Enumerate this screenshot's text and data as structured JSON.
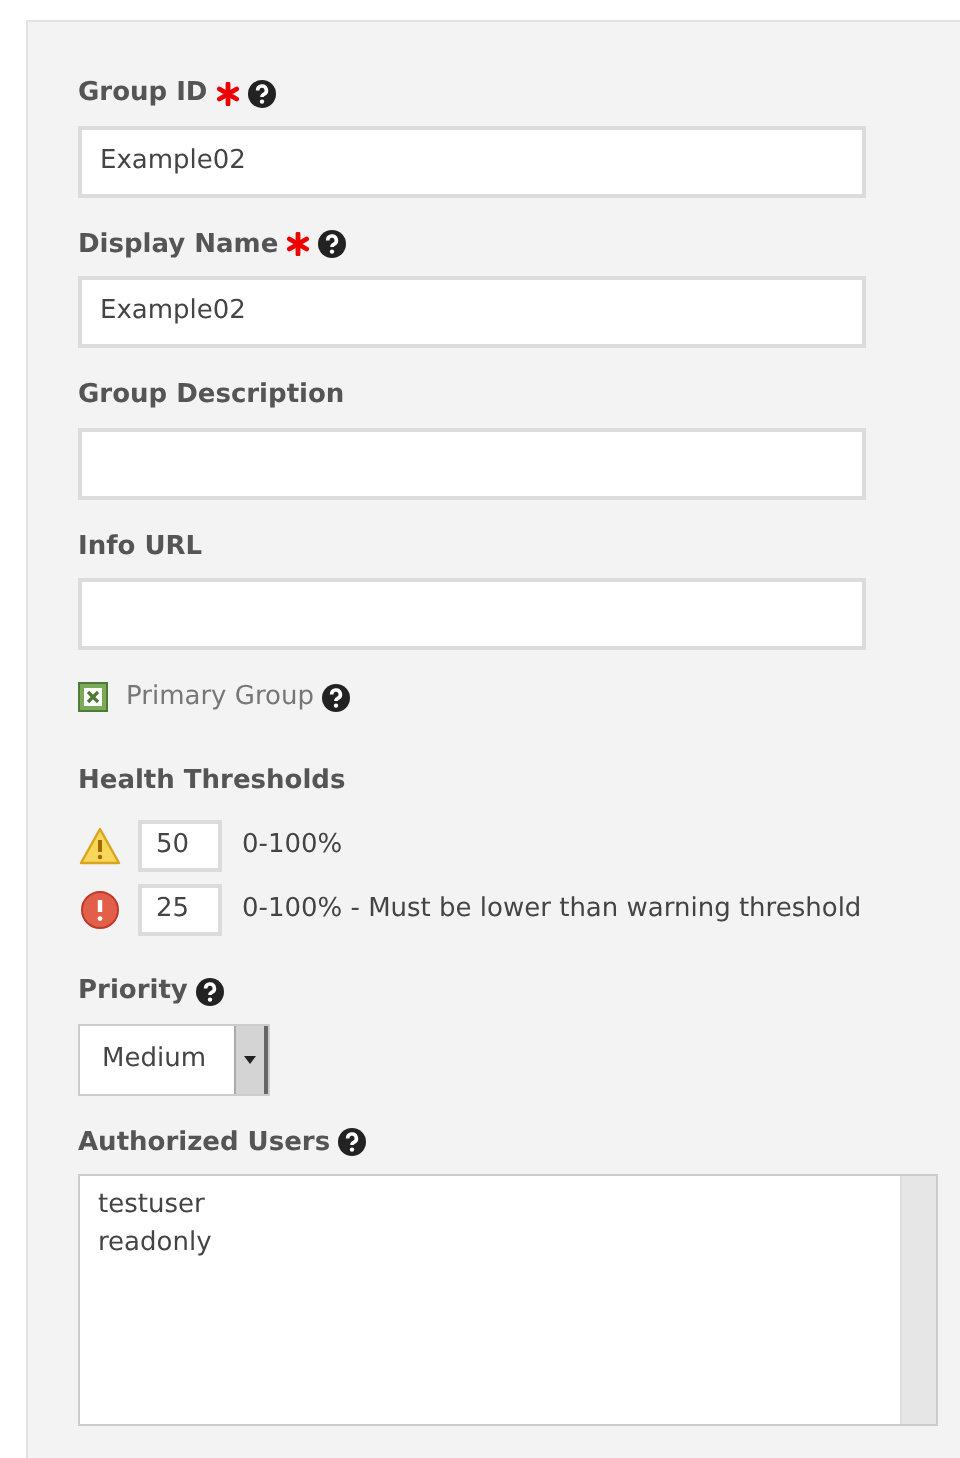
{
  "fields": [
    {
      "label": "Group ID",
      "required": true,
      "help": true,
      "value": "Example02"
    },
    {
      "label": "Display Name",
      "required": true,
      "help": true,
      "value": "Example02"
    },
    {
      "label": "Group Description",
      "required": false,
      "help": false
    },
    {
      "label": "Info URL",
      "required": false,
      "help": false
    }
  ],
  "primary_group": {
    "label": "Primary Group",
    "checked": true,
    "help": true
  },
  "health_thresholds": {
    "title": "Health Thresholds",
    "rows": [
      {
        "kind": "warning",
        "value": "50",
        "note": "0-100%"
      },
      {
        "kind": "critical",
        "value": "25",
        "note": "0-100% - Must be lower than warning threshold"
      }
    ]
  },
  "priority": {
    "label": "Priority",
    "help": true,
    "value": "Medium"
  },
  "authorized_users": {
    "label": "Authorized Users",
    "help": true,
    "lines": [
      "testuser",
      "readonly"
    ]
  }
}
